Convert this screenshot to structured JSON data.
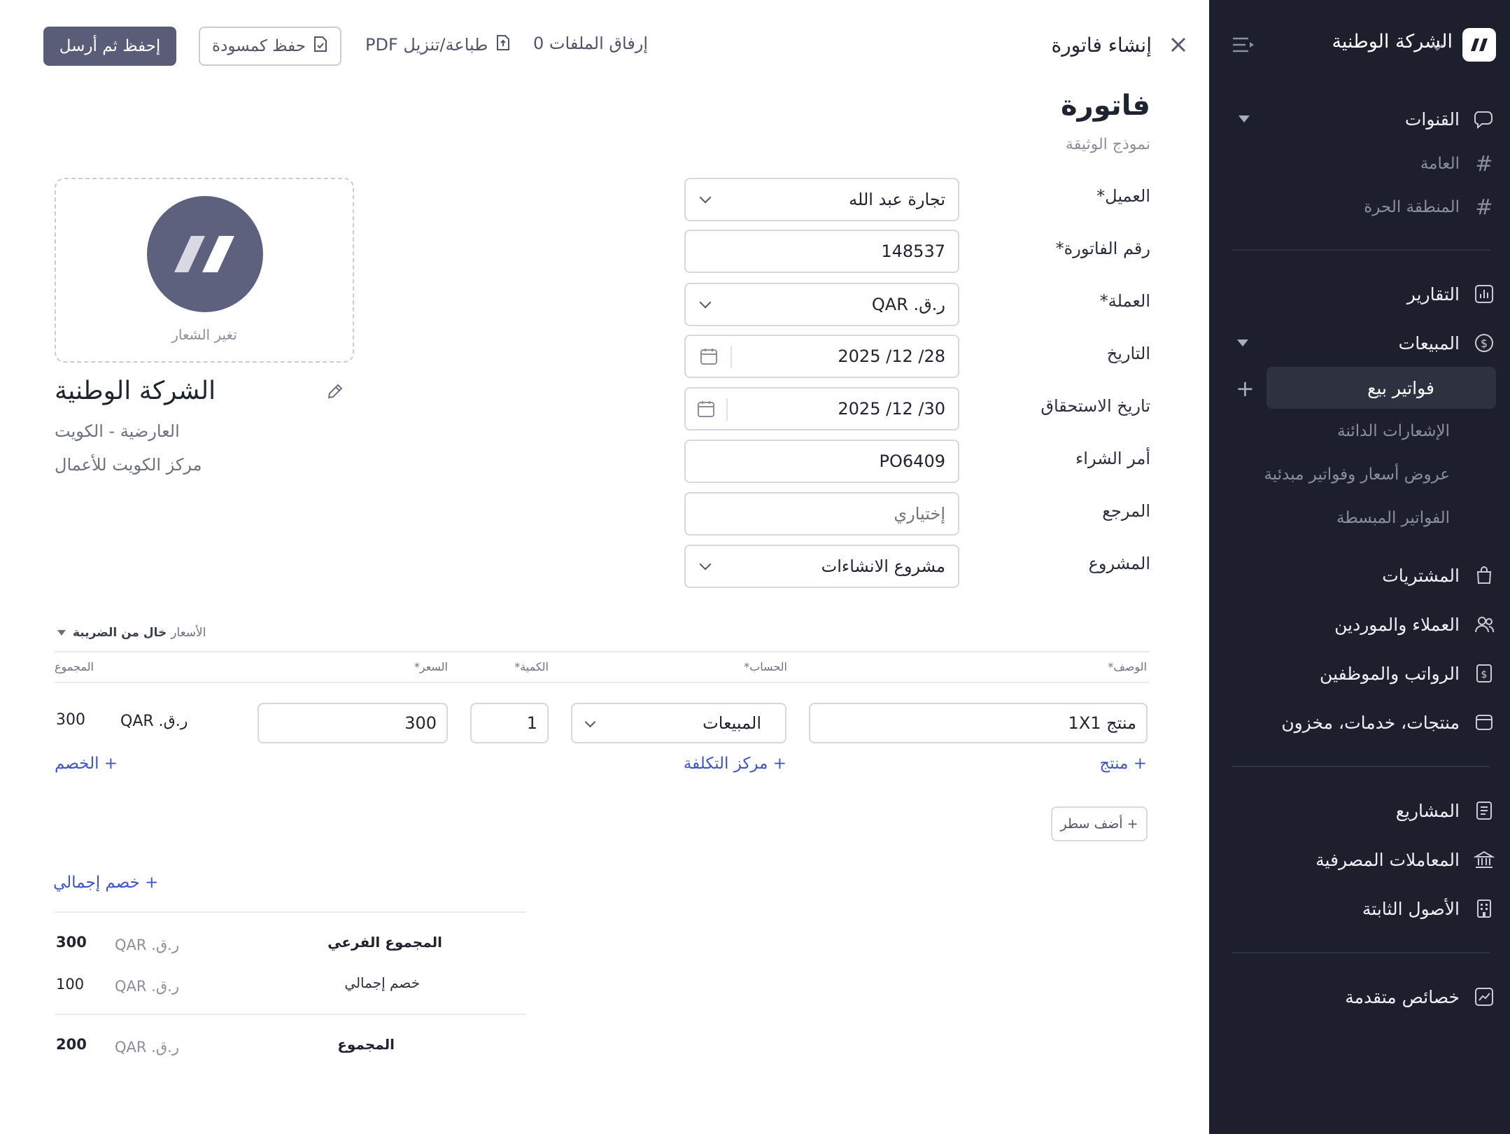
{
  "sidebar": {
    "company_name": "الشركة الوطنية",
    "nav": {
      "channels": "القنوات",
      "channel_general": "العامة",
      "channel_freezone": "المنطقة الحرة",
      "reports": "التقارير",
      "sales": "المبيعات",
      "sales_invoices": "فواتير بيع",
      "credit_notes": "الإشعارات الدائنة",
      "quotes": "عروض أسعار وفواتير مبدئية",
      "simple_invoices": "الفواتير المبسطة",
      "purchases": "المشتريات",
      "customers_suppliers": "العملاء والموردين",
      "payroll": "الرواتب والموظفين",
      "products": "منتجات، خدمات، مخزون",
      "projects": "المشاريع",
      "banking": "المعاملات المصرفية",
      "fixed_assets": "الأصول الثابتة",
      "advanced": "خصائص متقدمة"
    }
  },
  "header": {
    "title": "إنشاء فاتورة",
    "attach_files": "إرفاق الملفات 0",
    "print_pdf": "طباعة/تنزيل PDF",
    "save_draft": "حفظ كمسودة",
    "save_send": "إحفظ ثم أرسل"
  },
  "document": {
    "type_title": "فاتورة",
    "type_subtitle": "نموذج الوثيقة"
  },
  "form": {
    "customer_label": "العميل*",
    "customer_value": "تجارة عبد الله",
    "invoice_number_label": "رقم الفاتورة*",
    "invoice_number_value": "148537",
    "currency_label": "العملة*",
    "currency_value": "ر.ق. QAR",
    "date_label": "التاريخ",
    "date_value": "28/ 12/ 2025",
    "due_date_label": "تاريخ الاستحقاق",
    "due_date_value": "30/ 12/ 2025",
    "po_label": "أمر الشراء",
    "po_value": "PO6409",
    "reference_label": "المرجع",
    "reference_placeholder": "إختياري",
    "project_label": "المشروع",
    "project_value": "مشروع الانشاءات"
  },
  "company": {
    "change_logo": "تغير الشعار",
    "name": "الشركة الوطنية",
    "address_line1": "العارضية - الكويت",
    "address_line2": "مركز الكويت للأعمال"
  },
  "lines": {
    "tax_mode_prefix": "الأسعار",
    "tax_mode_value": "خال من الضريبة",
    "headers": {
      "description": "الوصف*",
      "account": "الحساب*",
      "quantity": "الكمية*",
      "price": "السعر*",
      "total": "المجموع"
    },
    "rows": [
      {
        "description": "منتج 1X1",
        "account": "المبيعات",
        "quantity": "1",
        "price": "300",
        "currency": "ر.ق. QAR",
        "total": "300"
      }
    ],
    "add_product": "+ منتج",
    "add_cost_center": "+ مركز التكلفة",
    "add_discount": "+ الخصم",
    "add_line": "+ أضف سطر"
  },
  "totals": {
    "add_overall_discount": "+ خصم إجمالي",
    "subtotal_label": "المجموع الفرعي",
    "subtotal_currency": "ر.ق. QAR",
    "subtotal_value": "300",
    "discount_label": "خصم إجمالي",
    "discount_currency": "ر.ق. QAR",
    "discount_value": "100",
    "total_label": "المجموع",
    "total_currency": "ر.ق. QAR",
    "total_value": "200"
  },
  "colors": {
    "sidebar_bg": "#1d202c",
    "primary_button": "#5a5d78",
    "link_blue": "#3d55c8"
  }
}
